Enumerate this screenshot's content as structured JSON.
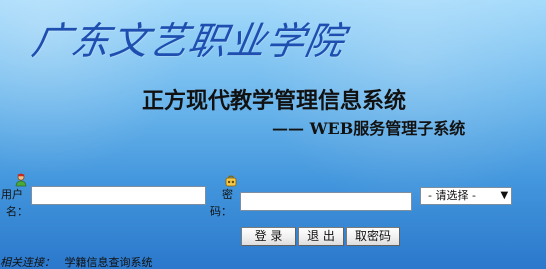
{
  "header": {
    "school_name": "广东文艺职业学院",
    "system_title": "正方现代教学管理信息系统",
    "system_subtitle": "—— WEB服务管理子系统"
  },
  "login_form": {
    "username_label_line1": "用户",
    "username_label_line2": "名：",
    "password_label_line1": "密",
    "password_label_line2": "码：",
    "username_value": "",
    "password_value": "",
    "role_select": {
      "selected": "- 请选择 -"
    },
    "buttons": {
      "login": "登 录",
      "exit": "退 出",
      "reset_password": "取密码"
    }
  },
  "footer": {
    "label": "相关连接：",
    "link_text": "学籍信息查询系统"
  },
  "icons": {
    "user": "user-icon",
    "key": "key-icon",
    "dropdown": "chevron-down-icon"
  },
  "colors": {
    "background_top": "#9fd8fb",
    "background_bottom": "#2b78cc",
    "logo_text": "#1d4eb0"
  }
}
